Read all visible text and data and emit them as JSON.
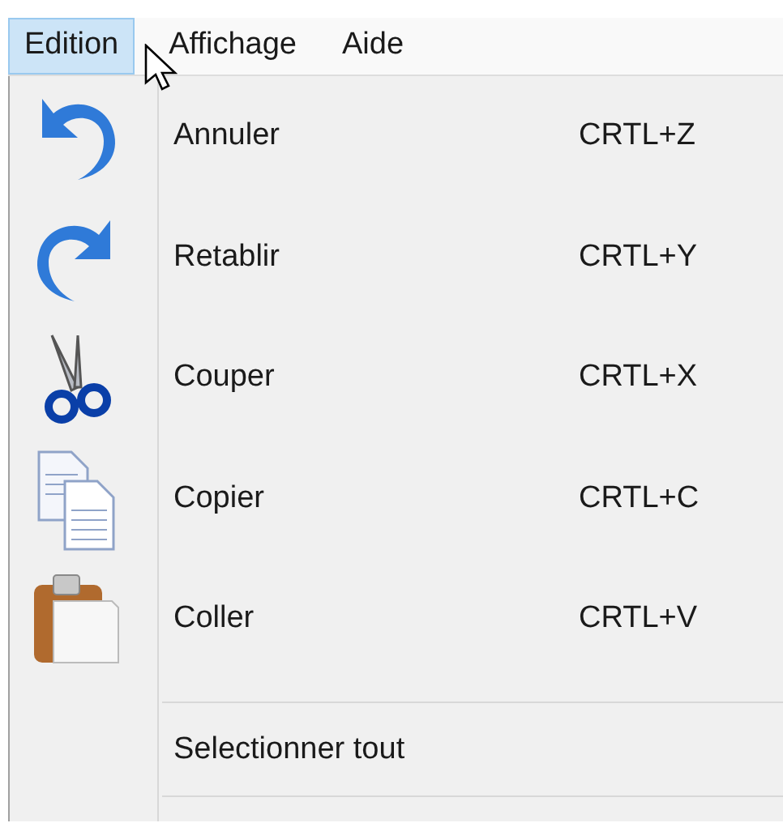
{
  "menubar": [
    {
      "label": "Edition",
      "selected": true
    },
    {
      "label": "Affichage",
      "selected": false
    },
    {
      "label": "Aide",
      "selected": false
    }
  ],
  "menu": {
    "items": [
      {
        "kind": "icon",
        "label": "Annuler",
        "shortcut": "CRTL+Z"
      },
      {
        "kind": "icon",
        "label": "Retablir",
        "shortcut": "CRTL+Y"
      },
      {
        "kind": "icon",
        "label": "Couper",
        "shortcut": "CRTL+X"
      },
      {
        "kind": "icon",
        "label": "Copier",
        "shortcut": "CRTL+C"
      },
      {
        "kind": "icon",
        "label": "Coller",
        "shortcut": "CRTL+V"
      },
      {
        "kind": "separator"
      },
      {
        "kind": "plain",
        "label": "Selectionner tout"
      },
      {
        "kind": "separator"
      }
    ]
  }
}
